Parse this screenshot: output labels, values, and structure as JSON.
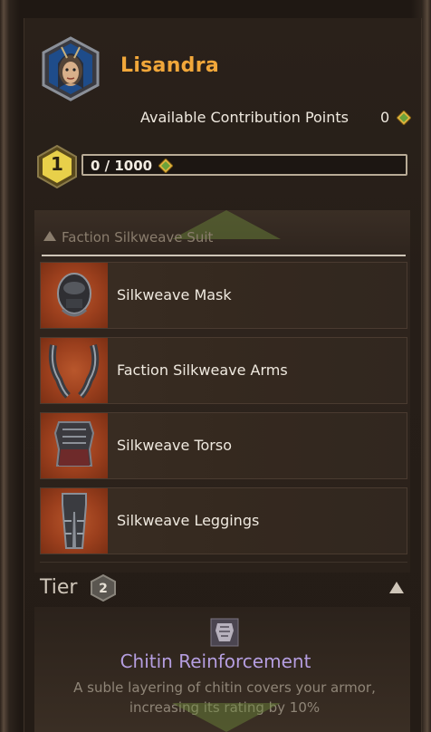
{
  "faction": {
    "name": "Lisandra",
    "contribution_label": "Available Contribution Points",
    "contribution_value": "0",
    "rank": "1",
    "progress_text": "0 / 1000",
    "progress_fraction": 0
  },
  "suit": {
    "header": "Faction Silkweave Suit",
    "items": [
      {
        "label": "Silkweave Mask",
        "icon": "mask-icon"
      },
      {
        "label": "Faction Silkweave Arms",
        "icon": "arms-icon"
      },
      {
        "label": "Silkweave Torso",
        "icon": "torso-icon"
      },
      {
        "label": "Silkweave Leggings",
        "icon": "leggings-icon"
      }
    ]
  },
  "tier": {
    "label": "Tier",
    "number": "2",
    "perk_title": "Chitin Reinforcement",
    "perk_desc": "A suble layering of chitin covers your armor, increasing its rating by 10%"
  },
  "colors": {
    "accent": "#f1a73a",
    "perk": "#b59ee0",
    "thumb": "#9b3f1d"
  }
}
